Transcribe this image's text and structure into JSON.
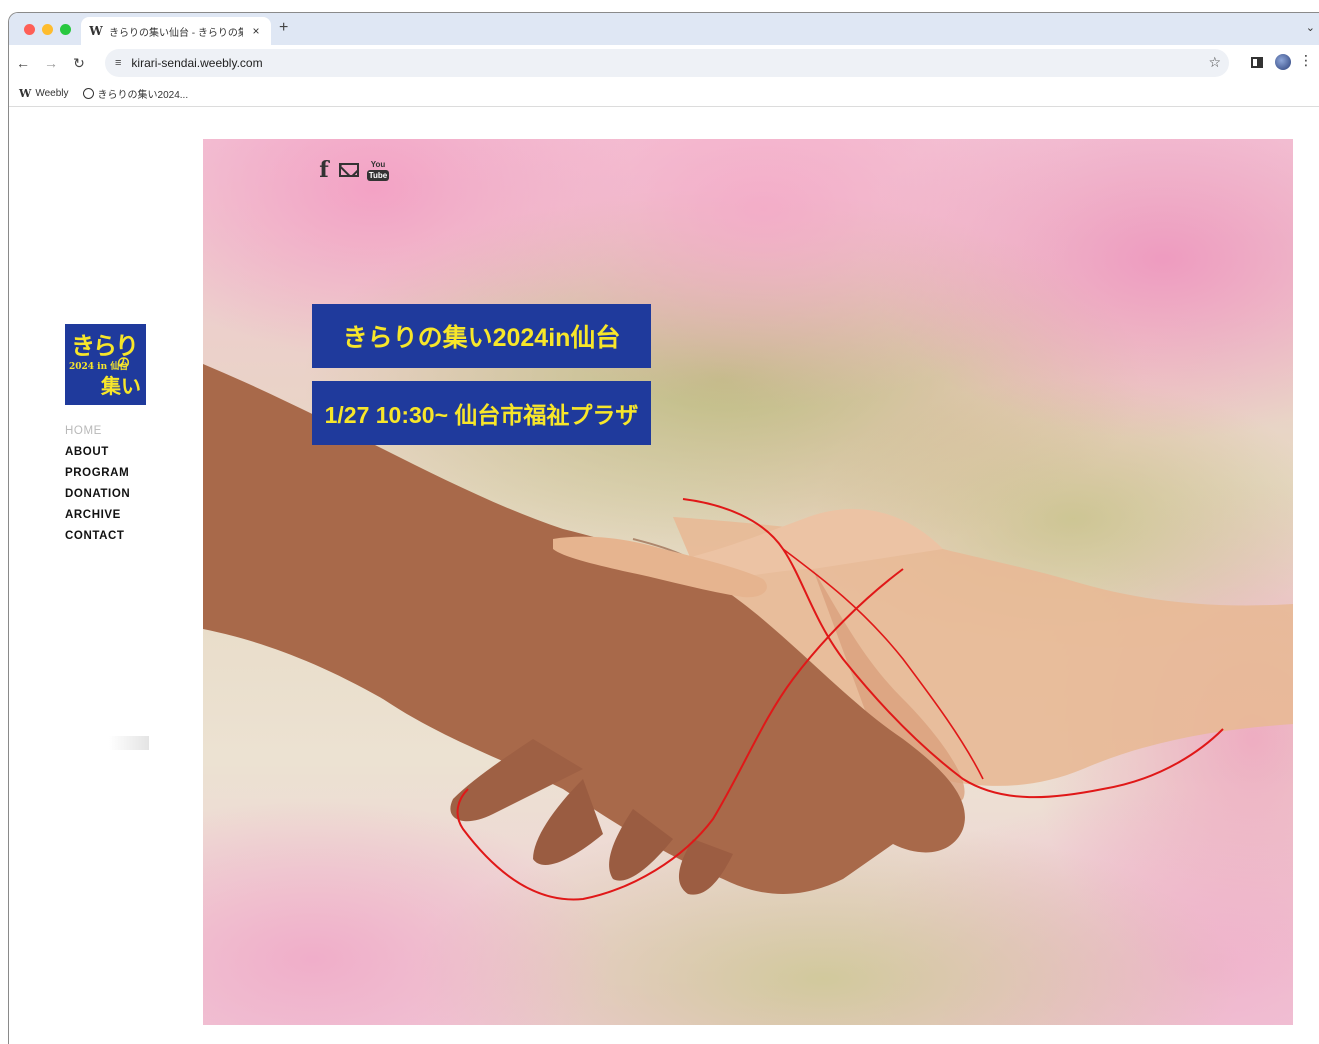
{
  "browser": {
    "tab_title": "きらりの集い仙台 - きらりの集い",
    "tab_favicon": "W",
    "tab_close": "×",
    "new_tab": "+",
    "tab_menu": "⌄",
    "url": "kirari-sendai.weebly.com",
    "bookmarks": [
      {
        "label": "Weebly",
        "icon": "W"
      },
      {
        "label": "きらりの集い2024...",
        "icon": "globe-icon"
      }
    ]
  },
  "site": {
    "logo": {
      "line1": "きらり",
      "line2": "の",
      "line3": "2024 in 仙台",
      "line4": "集い"
    },
    "nav": [
      {
        "label": "HOME",
        "active": true
      },
      {
        "label": "ABOUT",
        "active": false
      },
      {
        "label": "PROGRAM",
        "active": false
      },
      {
        "label": "DONATION",
        "active": false
      },
      {
        "label": "ARCHIVE",
        "active": false
      },
      {
        "label": "CONTACT",
        "active": false
      }
    ],
    "social": {
      "facebook": "f",
      "youtube_top": "You",
      "youtube_bottom": "Tube"
    },
    "hero": {
      "title": "きらりの集い2024in仙台",
      "date_venue": "1/27 10:30~ 仙台市福祉プラザ"
    }
  },
  "colors": {
    "banner_bg": "#1f3a9c",
    "banner_text": "#f7e62a",
    "thread": "#e01818"
  }
}
